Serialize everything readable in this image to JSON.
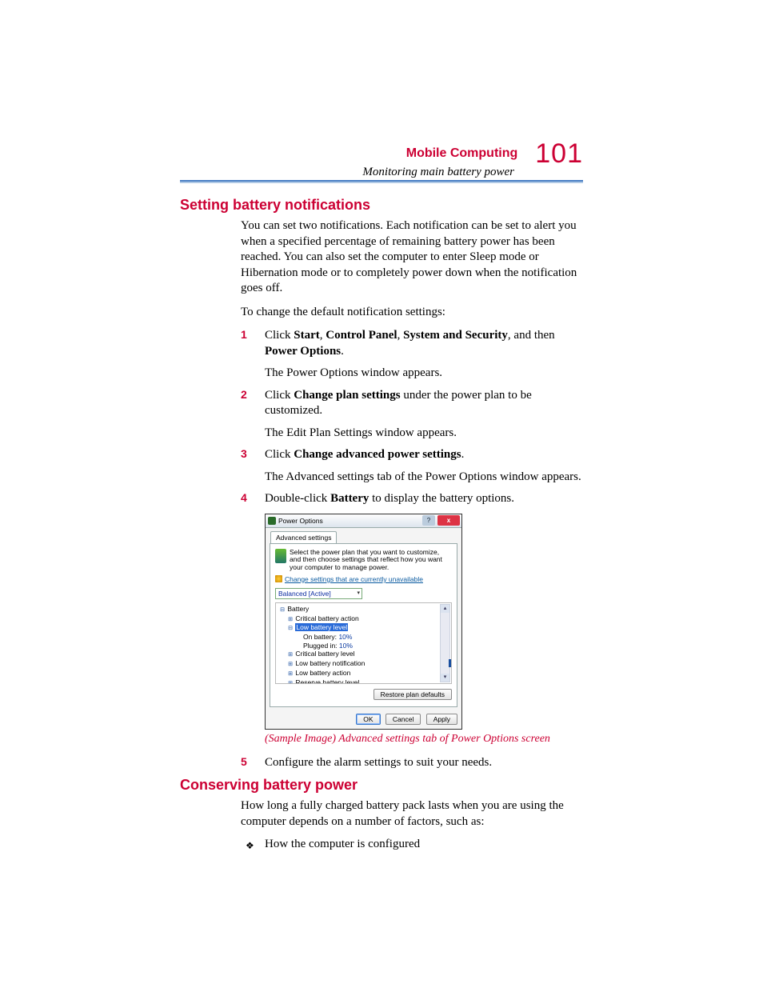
{
  "header": {
    "chapter": "Mobile Computing",
    "subtitle": "Monitoring main battery power",
    "page_number": "101"
  },
  "section1": {
    "title": "Setting battery notifications",
    "p1": "You can set two notifications. Each notification can be set to alert you when a specified percentage of remaining battery power has been reached. You can also set the computer to enter Sleep mode or Hibernation mode or to completely power down when the notification goes off.",
    "p2": "To change the default notification settings:"
  },
  "steps": {
    "s1": {
      "num": "1",
      "t1a": "Click ",
      "t1b_start": "Start",
      "t1c": ", ",
      "t1b_cp": "Control Panel",
      "t1d": ", ",
      "t1b_ss": "System and Security",
      "t1e": ", and then ",
      "t1b_po": "Power Options",
      "t1f": ".",
      "t2": "The Power Options window appears."
    },
    "s2": {
      "num": "2",
      "t1a": "Click ",
      "t1b": "Change plan settings",
      "t1c": " under the power plan to be customized.",
      "t2": "The Edit Plan Settings window appears."
    },
    "s3": {
      "num": "3",
      "t1a": "Click ",
      "t1b": "Change advanced power settings",
      "t1c": ".",
      "t2": "The Advanced settings tab of the Power Options window appears."
    },
    "s4": {
      "num": "4",
      "t1a": "Double-click ",
      "t1b": "Battery",
      "t1c": " to display the battery options."
    },
    "s5": {
      "num": "5",
      "t1": "Configure the alarm settings to suit your needs."
    }
  },
  "dialog": {
    "title": "Power Options",
    "tab": "Advanced settings",
    "desc": "Select the power plan that you want to customize, and then choose settings that reflect how you want your computer to manage power.",
    "link": "Change settings that are currently unavailable",
    "combo": "Balanced [Active]",
    "tree": {
      "root": "Battery",
      "n1": "Critical battery action",
      "n2": "Low battery level",
      "n2a_label": "On battery:",
      "n2a_val": "10%",
      "n2b_label": "Plugged in:",
      "n2b_val": "10%",
      "n3": "Critical battery level",
      "n4": "Low battery notification",
      "n5": "Low battery action",
      "n6": "Reserve battery level"
    },
    "restore": "Restore plan defaults",
    "ok": "OK",
    "cancel": "Cancel",
    "apply": "Apply"
  },
  "caption": "(Sample Image) Advanced settings tab of Power Options screen",
  "section2": {
    "title": "Conserving battery power",
    "p1": "How long a fully charged battery pack lasts when you are using the computer depends on a number of factors, such as:",
    "b1": "How the computer is configured"
  }
}
